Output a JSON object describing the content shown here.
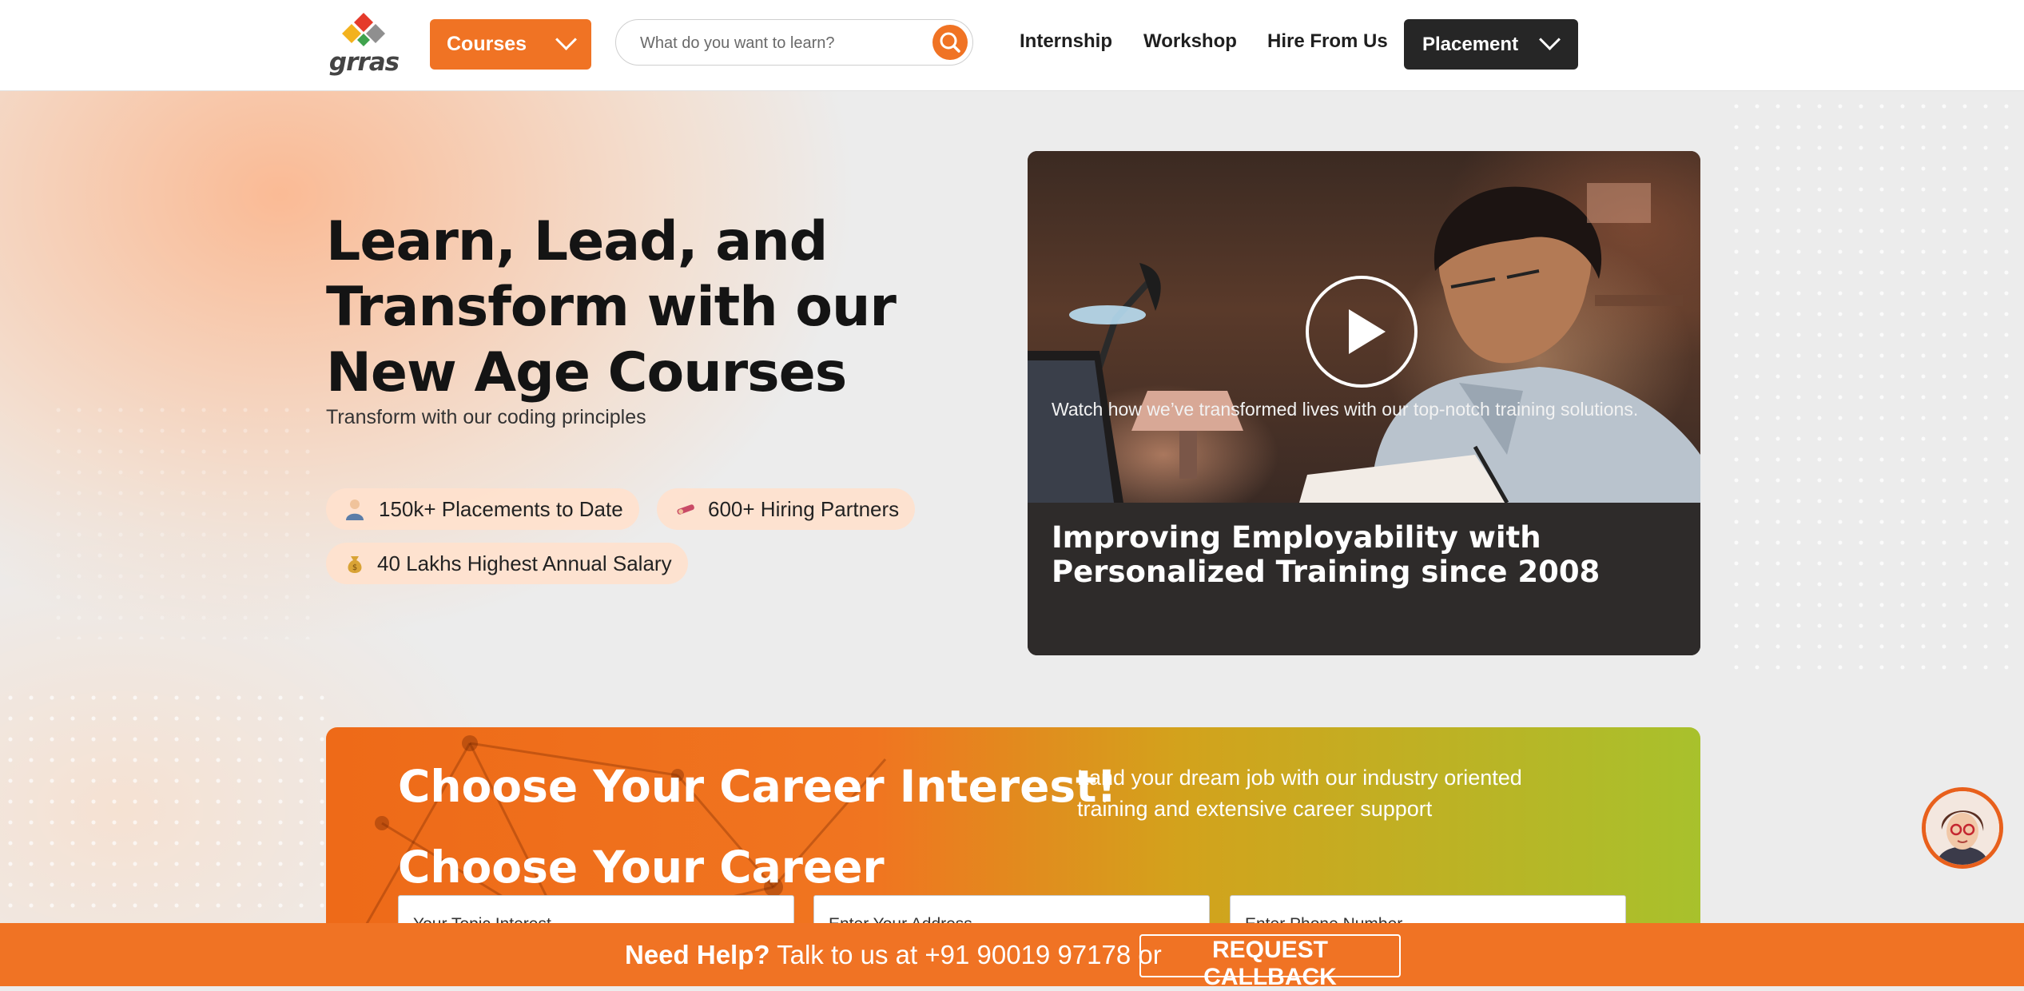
{
  "header": {
    "logo_text": "grras",
    "courses_label": "Courses",
    "search_placeholder": "What do you want to learn?",
    "nav": [
      "Internship",
      "Workshop",
      "Hire From Us"
    ],
    "placement_label": "Placement"
  },
  "hero": {
    "title": "Learn, Lead, and Transform with our New Age Courses",
    "subtitle": "Transform with our coding principles",
    "stats": [
      {
        "icon": "person-icon",
        "label": "150k+ Placements to Date"
      },
      {
        "icon": "handshake-icon",
        "label": "600+ Hiring Partners"
      },
      {
        "icon": "money-bag-icon",
        "label": "40 Lakhs Highest Annual Salary"
      }
    ]
  },
  "video": {
    "title": "Improving Employability with Personalized Training since 2008",
    "description": "Watch how we’ve transformed lives with our top-notch training solutions."
  },
  "career": {
    "heading": "Choose Your Career Interest!",
    "description": "Land your dream job with our industry oriented training and extensive career support",
    "form_heading": "Choose Your Career",
    "fields": {
      "topic_placeholder": "Your Topic Interest",
      "address_placeholder": "Enter Your Address",
      "phone_placeholder": "Enter Phone Number"
    }
  },
  "help": {
    "prefix": "Need Help?",
    "text": " Talk to us at +91 90019 97178 or",
    "callback_label": "REQUEST CALLBACK"
  },
  "colors": {
    "accent": "#f07324",
    "dark": "#262626",
    "green": "#a8c12c"
  }
}
